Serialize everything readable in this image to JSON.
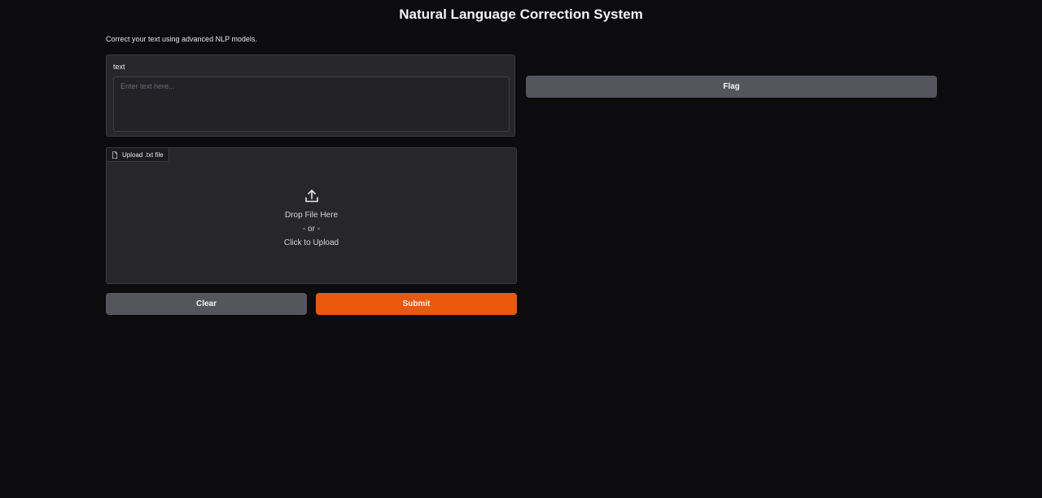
{
  "header": {
    "title": "Natural Language Correction System",
    "description": "Correct your text using advanced NLP models."
  },
  "text_input": {
    "label": "text",
    "placeholder": "Enter text here...",
    "value": ""
  },
  "file_upload": {
    "label": "Upload .txt file",
    "drop_text": "Drop File Here",
    "or_text": "- or -",
    "click_text": "Click to Upload",
    "icons": [
      "file-icon",
      "upload-icon"
    ]
  },
  "actions": {
    "clear_label": "Clear",
    "submit_label": "Submit",
    "flag_label": "Flag"
  },
  "colors": {
    "background": "#0c0c0f",
    "panel": "#27272a",
    "secondary_button": "#55555d",
    "primary_button": "#ea580c"
  }
}
